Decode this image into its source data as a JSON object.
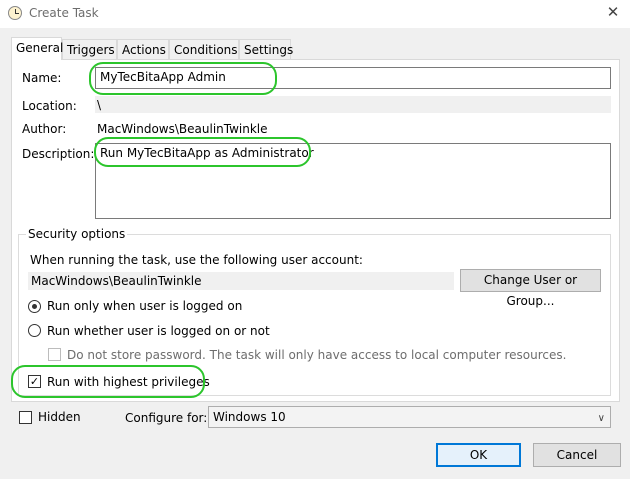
{
  "window": {
    "title": "Create Task",
    "close_icon": "close-icon"
  },
  "tabs": [
    "General",
    "Triggers",
    "Actions",
    "Conditions",
    "Settings"
  ],
  "general": {
    "name_label": "Name:",
    "name_value": "MyTecBitaApp Admin",
    "location_label": "Location:",
    "location_value": "\\",
    "author_label": "Author:",
    "author_value": "MacWindows\\BeaulinTwinkle",
    "description_label": "Description:",
    "description_value": "Run MyTecBitaApp as Administrator"
  },
  "security": {
    "title": "Security options",
    "account_prompt": "When running the task, use the following user account:",
    "account_value": "MacWindows\\BeaulinTwinkle",
    "change_button": "Change User or Group...",
    "radio_logged_on": "Run only when user is logged on",
    "radio_logged_on_selected": true,
    "radio_whether": "Run whether user is logged on or not",
    "no_store_password": "Do not store password.  The task will only have access to local computer resources.",
    "highest_privileges": "Run with highest privileges",
    "highest_privileges_checked": true
  },
  "bottom": {
    "hidden_label": "Hidden",
    "configure_label": "Configure for:",
    "configure_value": "Windows 10"
  },
  "buttons": {
    "ok": "OK",
    "cancel": "Cancel"
  },
  "colors": {
    "highlight": "#2cc52c",
    "default_button_border": "#0078d7"
  }
}
